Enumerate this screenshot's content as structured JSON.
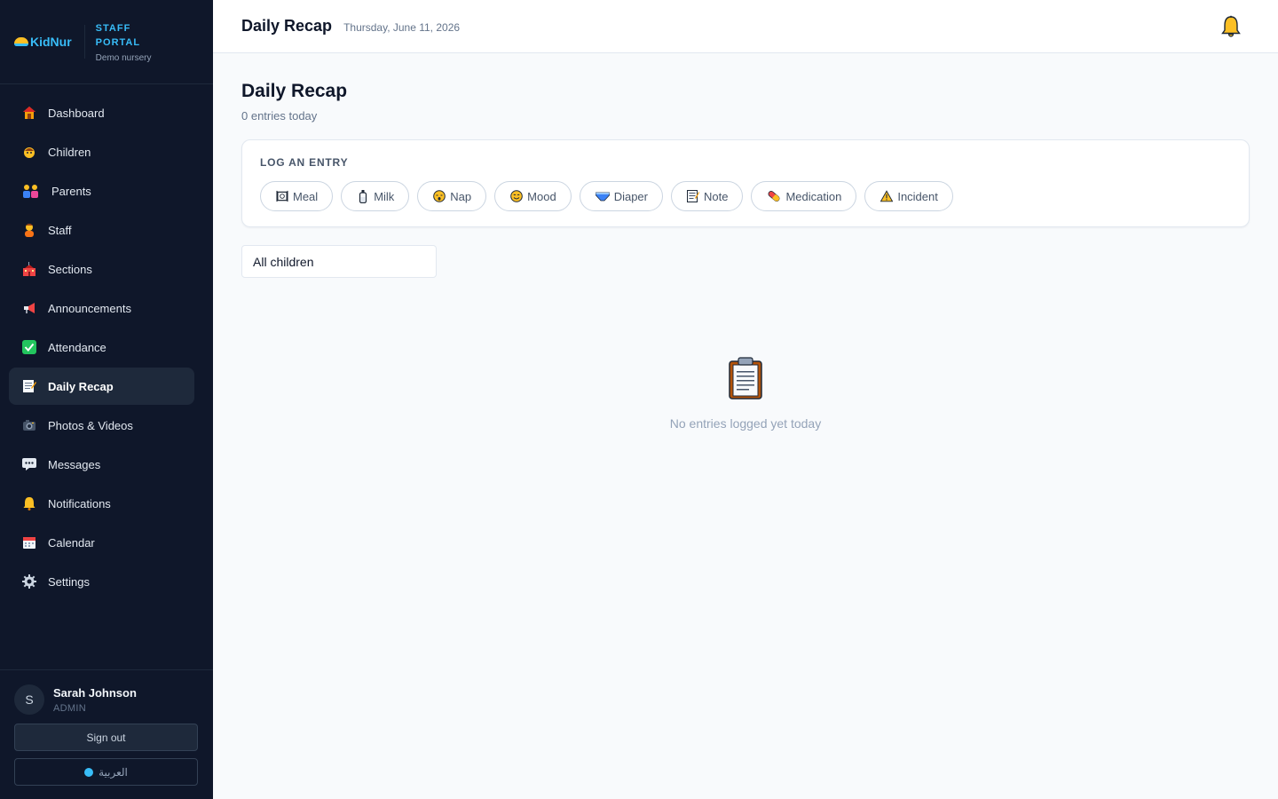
{
  "brand": {
    "logo_text": "KidNur",
    "portal_title": "STAFF PORTAL",
    "org_name": "Demo nursery"
  },
  "sidebar": {
    "items": [
      {
        "label": "Dashboard",
        "icon": "house-icon"
      },
      {
        "label": "Children",
        "icon": "child-face-icon"
      },
      {
        "label": "Parents",
        "icon": "family-icon"
      },
      {
        "label": "Staff",
        "icon": "staff-person-icon"
      },
      {
        "label": "Sections",
        "icon": "school-icon"
      },
      {
        "label": "Announcements",
        "icon": "megaphone-icon"
      },
      {
        "label": "Attendance",
        "icon": "checkbox-icon"
      },
      {
        "label": "Daily Recap",
        "icon": "memo-icon",
        "active": true
      },
      {
        "label": "Photos & Videos",
        "icon": "camera-icon"
      },
      {
        "label": "Messages",
        "icon": "speech-bubble-icon"
      },
      {
        "label": "Notifications",
        "icon": "bell-icon"
      },
      {
        "label": "Calendar",
        "icon": "calendar-icon"
      },
      {
        "label": "Settings",
        "icon": "gear-icon"
      }
    ]
  },
  "user": {
    "initial": "S",
    "name": "Sarah Johnson",
    "role": "ADMIN",
    "sign_out_label": "Sign out",
    "language_label": "العربية"
  },
  "topbar": {
    "title": "Daily Recap",
    "date": "Thursday, June 11, 2026"
  },
  "main": {
    "title": "Daily Recap",
    "subtitle": "0 entries today",
    "log_entry": {
      "label": "LOG AN ENTRY",
      "chips": [
        {
          "label": "Meal",
          "icon": "meal-icon"
        },
        {
          "label": "Milk",
          "icon": "bottle-icon"
        },
        {
          "label": "Nap",
          "icon": "sleepy-face-icon"
        },
        {
          "label": "Mood",
          "icon": "smile-face-icon"
        },
        {
          "label": "Diaper",
          "icon": "diaper-icon"
        },
        {
          "label": "Note",
          "icon": "memo-icon"
        },
        {
          "label": "Medication",
          "icon": "pill-icon"
        },
        {
          "label": "Incident",
          "icon": "warning-icon"
        }
      ]
    },
    "filter": {
      "selected": "All children"
    },
    "empty_state": {
      "icon": "clipboard-icon",
      "text": "No entries logged yet today"
    }
  },
  "colors": {
    "sidebar_bg": "#0f172a",
    "accent": "#38bdf8",
    "active_item_bg": "#1e293b",
    "page_bg": "#f8fafc"
  }
}
